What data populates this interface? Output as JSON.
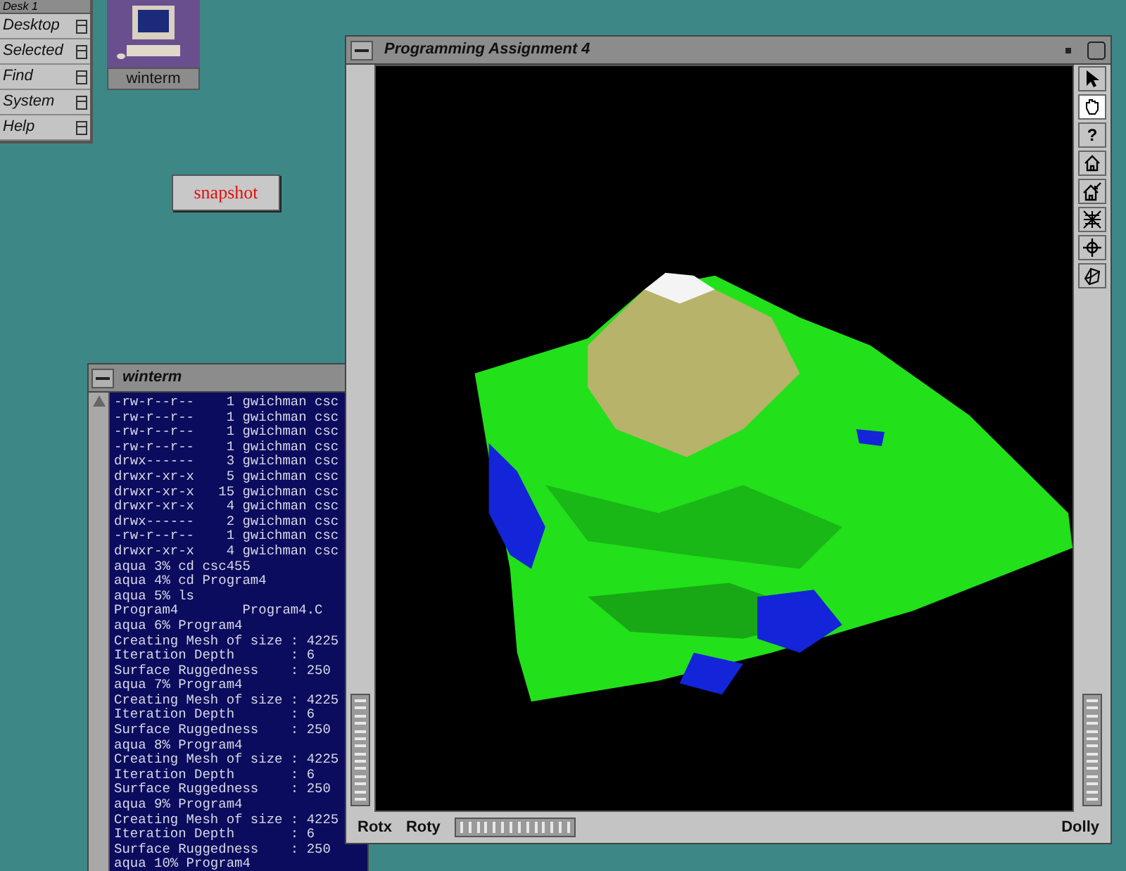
{
  "toolchest": {
    "title": "Desk 1",
    "items": [
      {
        "label": "Desktop"
      },
      {
        "label": "Selected"
      },
      {
        "label": "Find"
      },
      {
        "label": "System"
      },
      {
        "label": "Help"
      }
    ]
  },
  "desktop_icons": [
    {
      "label": "winterm"
    }
  ],
  "snapshot_button": {
    "label": "snapshot"
  },
  "terminal": {
    "title": "winterm",
    "lines": [
      "-rw-r--r--    1 gwichman csc",
      "-rw-r--r--    1 gwichman csc",
      "-rw-r--r--    1 gwichman csc",
      "-rw-r--r--    1 gwichman csc",
      "drwx------    3 gwichman csc",
      "drwxr-xr-x    5 gwichman csc",
      "drwxr-xr-x   15 gwichman csc",
      "drwxr-xr-x    4 gwichman csc",
      "drwx------    2 gwichman csc",
      "-rw-r--r--    1 gwichman csc",
      "drwxr-xr-x    4 gwichman csc",
      "aqua 3% cd csc455",
      "aqua 4% cd Program4",
      "aqua 5% ls",
      "Program4        Program4.C",
      "aqua 6% Program4",
      "Creating Mesh of size : 4225",
      "Iteration Depth       : 6",
      "Surface Ruggedness    : 250",
      "aqua 7% Program4",
      "Creating Mesh of size : 4225",
      "Iteration Depth       : 6",
      "Surface Ruggedness    : 250",
      "aqua 8% Program4",
      "Creating Mesh of size : 4225",
      "Iteration Depth       : 6",
      "Surface Ruggedness    : 250",
      "aqua 9% Program4",
      "Creating Mesh of size : 4225",
      "Iteration Depth       : 6",
      "Surface Ruggedness    : 250",
      "aqua 10% Program4"
    ]
  },
  "viewer": {
    "title": "Programming Assignment 4",
    "tools": [
      {
        "kind": "pick",
        "selected": false
      },
      {
        "kind": "hand",
        "selected": true
      },
      {
        "kind": "help",
        "glyph": "?",
        "selected": false
      },
      {
        "kind": "home",
        "selected": false
      },
      {
        "kind": "set-home",
        "selected": false
      },
      {
        "kind": "view-all",
        "selected": false
      },
      {
        "kind": "seek",
        "selected": false
      },
      {
        "kind": "projection",
        "selected": false
      }
    ],
    "rotx_label": "Rotx",
    "roty_label": "Roty",
    "dolly_label": "Dolly"
  }
}
